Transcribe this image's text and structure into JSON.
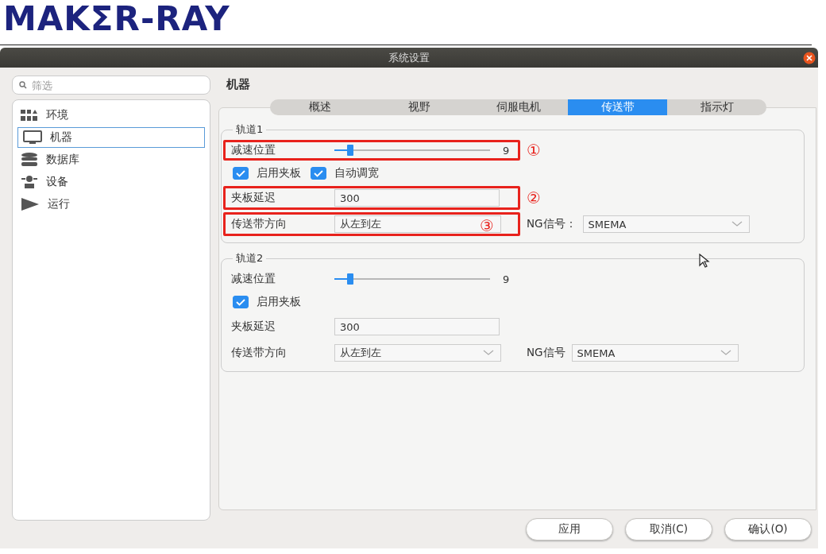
{
  "logo": {
    "text": "MAKΣR-RAY"
  },
  "window": {
    "title": "系统设置"
  },
  "sidebar": {
    "search": {
      "placeholder": "筛选"
    },
    "items": [
      {
        "label": "环境",
        "selected": false
      },
      {
        "label": "机器",
        "selected": true
      },
      {
        "label": "数据库",
        "selected": false
      },
      {
        "label": "设备",
        "selected": false
      },
      {
        "label": "运行",
        "selected": false
      }
    ]
  },
  "page": {
    "heading": "机器"
  },
  "tabs": [
    {
      "label": "概述",
      "selected": false
    },
    {
      "label": "视野",
      "selected": false
    },
    {
      "label": "伺服电机",
      "selected": false
    },
    {
      "label": "传送带",
      "selected": true
    },
    {
      "label": "指示灯",
      "selected": false
    }
  ],
  "tracks": [
    {
      "title": "轨道1",
      "rows": [
        {
          "kind": "slider",
          "label": "减速位置",
          "level": 0.1,
          "reading": "9",
          "callout": "①"
        },
        {
          "kind": "checks",
          "checkboxes": [
            {
              "label": "启用夹板",
              "checked": true
            },
            {
              "label": "自动调宽",
              "checked": true
            }
          ]
        },
        {
          "kind": "field",
          "label": "夹板延迟",
          "value": "300",
          "callout": "②"
        },
        {
          "kind": "selects",
          "label": "传送带方向",
          "value": "从左到左",
          "ng_label": "NG信号：",
          "ng_value": "SMEMA",
          "callout": "③"
        }
      ]
    },
    {
      "title": "轨道2",
      "rows": [
        {
          "kind": "slider",
          "label": "减速位置",
          "level": 0.1,
          "reading": "9"
        },
        {
          "kind": "checks",
          "checkboxes": [
            {
              "label": "启用夹板",
              "checked": true
            }
          ]
        },
        {
          "kind": "field",
          "label": "夹板延迟",
          "value": "300"
        },
        {
          "kind": "selects",
          "label": "传送带方向",
          "value": "从左到左",
          "ng_label": "NG信号",
          "ng_value": "SMEMA"
        }
      ]
    }
  ],
  "buttons": [
    "应用",
    "取消(C)",
    "确认(O)"
  ]
}
